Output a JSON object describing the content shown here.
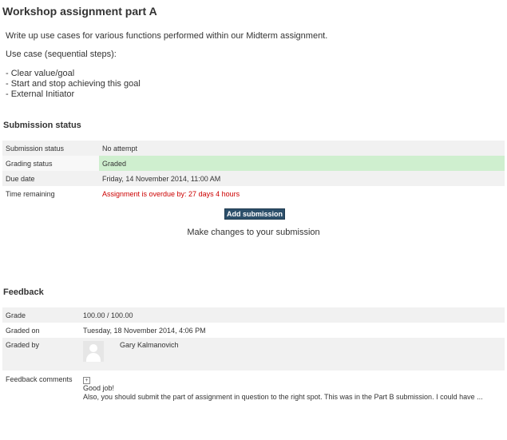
{
  "page": {
    "title": "Workshop assignment part A"
  },
  "intro": {
    "line1": "Write up use cases for various functions performed within our Midterm assignment.",
    "line2": "Use case (sequential steps):",
    "bullets": [
      "- Clear value/goal",
      "- Start and stop achieving this goal",
      "- External Initiator"
    ]
  },
  "submission": {
    "heading": "Submission status",
    "rows": [
      {
        "label": "Submission status",
        "value": "No attempt"
      },
      {
        "label": "Grading status",
        "value": "Graded"
      },
      {
        "label": "Due date",
        "value": "Friday, 14 November 2014, 11:00 AM"
      },
      {
        "label": "Time remaining",
        "value": "Assignment is overdue by: 27 days 4 hours"
      }
    ],
    "add_button": "Add submission",
    "make_changes": "Make changes to your submission"
  },
  "feedback": {
    "heading": "Feedback",
    "grade_label": "Grade",
    "grade_value": "100.00 / 100.00",
    "graded_on_label": "Graded on",
    "graded_on_value": "Tuesday, 18 November 2014, 4:06 PM",
    "graded_by_label": "Graded by",
    "grader_name": "Gary Kalmanovich",
    "comments_label": "Feedback comments",
    "comment_line1": "Good job!",
    "comment_line2": "Also, you should submit the part of assignment in question to the right spot. This was in the Part B submission. I could have ..."
  },
  "colors": {
    "graded_bg": "#cfefcf",
    "overdue_text": "#cc0000",
    "button_bg": "#2c4f6a"
  },
  "icons": {
    "expand": "plus-box-icon",
    "avatar": "user-avatar-icon"
  }
}
